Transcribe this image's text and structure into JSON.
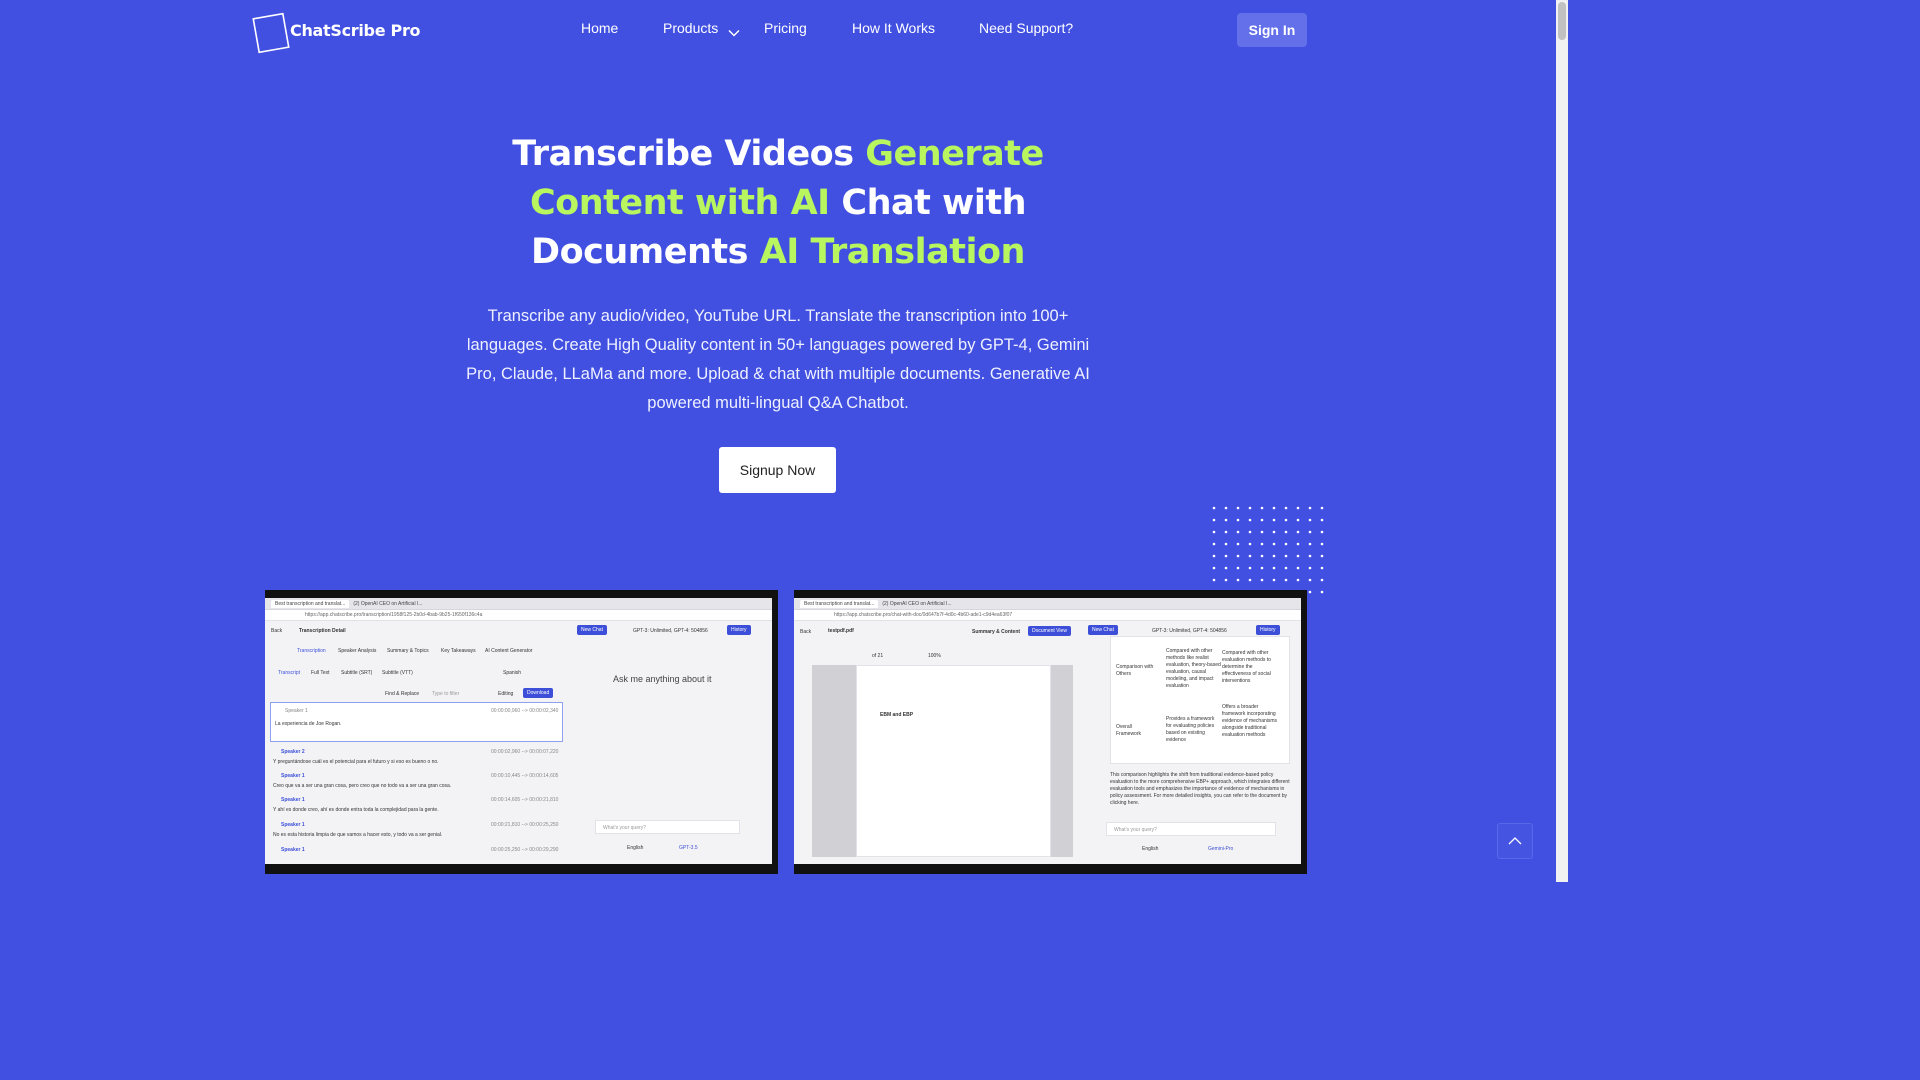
{
  "brand": {
    "name": "ChatScribe Pro"
  },
  "nav": {
    "home": "Home",
    "products": "Products",
    "pricing": "Pricing",
    "how": "How It Works",
    "support": "Need Support?",
    "signin": "Sign In"
  },
  "hero": {
    "t1": "Transcribe Videos ",
    "t2": "Generate Content with AI",
    "t3": " Chat with Documents ",
    "t4": "AI Translation",
    "subtitle": "Transcribe any audio/video, YouTube URL. Translate the transcription into 100+ languages. Create High Quality content in 50+ languages powered by GPT-4, Gemini Pro, Claude, LLaMa and more. Upload & chat with multiple documents. Generative AI powered multi-lingual Q&A Chatbot.",
    "cta": "Signup Now"
  },
  "shot_left": {
    "tab1": "Best transcription and translat...",
    "tab2": "(2) OpenAI CEO on Artificial I...",
    "url": "https://app.chatscribe.pro/transcription/1958f125-2b0d-4bab-9b25-1f650f136c4a",
    "back": "Back",
    "title": "Transcription Detail",
    "new_chat": "New Chat",
    "usage": "GPT-3: Unlimited, GPT-4: 504856",
    "history": "History",
    "tabs": [
      "Transcription",
      "Speaker Analysis",
      "Summary & Topics",
      "Key Takeaways",
      "AI Content Generator"
    ],
    "subtabs": [
      "Transcript",
      "Full Text",
      "Subtitle (SRT)",
      "Subtitle (VTT)"
    ],
    "language": "Spanish",
    "find": "Find & Replace",
    "filter_ph": "Type to filter",
    "editing": "Editing",
    "download": "Download",
    "ask": "Ask me anything about it",
    "query_ph": "What's your query?",
    "lang_select": "English",
    "model_select": "GPT-3.5",
    "rows": [
      {
        "speaker": "Speaker 1",
        "time": "00:00:00,960 --> 00:00:02,340",
        "text": "La experiencia de Joe Rogan."
      },
      {
        "speaker": "Speaker 2",
        "time": "00:00:02,960 --> 00:00:07,220",
        "text": "Y preguntándose cuál es el potencial para el futuro y si eso es bueno o no."
      },
      {
        "speaker": "Speaker 1",
        "time": "00:00:10,445 --> 00:00:14,605",
        "text": "Creo que va a ser una gran cosa, pero creo que no todo va a ser una gran cosa."
      },
      {
        "speaker": "Speaker 1",
        "time": "00:00:14,605 --> 00:00:21,810",
        "text": "Y ahí es donde creo, ahí es donde entra toda la complejidad para la gente."
      },
      {
        "speaker": "Speaker 1",
        "time": "00:00:21,810 --> 00:00:25,250",
        "text": "No es esta historia limpia de que vamos a hacer esto, y todo va a ser genial."
      },
      {
        "speaker": "Speaker 1",
        "time": "00:00:25,250 --> 00:00:29,290",
        "text": ""
      }
    ]
  },
  "shot_right": {
    "tab1": "Best transcription and translat...",
    "tab2": "(2) OpenAI CEO on Artificial I...",
    "url": "https://app.chatscribe.pro/chat-with-doc/0d647b7f-4d0c-4b60-ade1-c9d4ea63f07",
    "back": "Back",
    "title": "testpdf.pdf",
    "summary": "Summary & Content",
    "doc_view": "Document View",
    "new_chat": "New Chat",
    "usage": "GPT-3: Unlimited, GPT-4: 504856",
    "history": "History",
    "page": "of 21",
    "zoom": "100%",
    "table": [
      {
        "label": "Comparison with Others",
        "a": "Compared with other methods like realist evaluation, theory-based evaluation, causal modeling, and impact evaluation",
        "b": "Compared with other evaluation methods to determine the effectiveness of social interventions"
      },
      {
        "label": "Overall Framework",
        "a": "Provides a framework for evaluating policies based on existing evidence",
        "b": "Offers a broader framework incorporating evidence of mechanisms alongside traditional evaluation methods"
      }
    ],
    "answer": "This comparison highlights the shift from traditional evidence-based policy evaluation to the more comprehensive EBP+ approach, which integrates different evaluation tools and emphasizes the importance of evidence of mechanisms in policy assessment. For more detailed insights, you can refer to the document by clicking here.",
    "doc_heading": "EBM and EBP",
    "query_ph": "What's your query?",
    "lang_select": "English",
    "model_select": "Gemini-Pro"
  },
  "colors": {
    "bg": "#4150e0",
    "accent": "#b8f55e",
    "button": "#6470ea"
  },
  "icons": [
    "logo-square-icon",
    "chevron-down-icon",
    "chevron-up-icon"
  ]
}
